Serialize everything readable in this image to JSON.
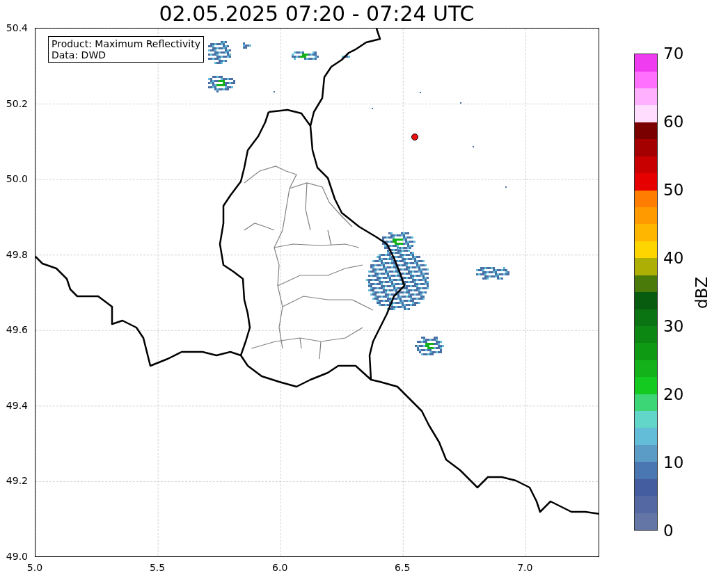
{
  "title": "02.05.2025 07:20 - 07:24 UTC",
  "legend": {
    "lines": [
      "Product: Maximum Reflectivity",
      "Data: DWD"
    ]
  },
  "axes": {
    "x_ticks": [
      "5.0",
      "5.5",
      "6.0",
      "6.5",
      "7.0"
    ],
    "y_ticks": [
      "50.4",
      "50.2",
      "50.0",
      "49.8",
      "49.6",
      "49.4",
      "49.2",
      "49.0"
    ]
  },
  "colorbar": {
    "label": "dBZ",
    "ticks": [
      "70",
      "60",
      "50",
      "40",
      "30",
      "20",
      "10",
      "0"
    ],
    "segments": [
      {
        "color": "#6376a6"
      },
      {
        "color": "#5468a3"
      },
      {
        "color": "#445da0"
      },
      {
        "color": "#4a77b2"
      },
      {
        "color": "#5b9cc6"
      },
      {
        "color": "#63bcd8"
      },
      {
        "color": "#62d6c8"
      },
      {
        "color": "#3dd676"
      },
      {
        "color": "#14c91f"
      },
      {
        "color": "#13b21a"
      },
      {
        "color": "#0f9a14"
      },
      {
        "color": "#0b8712"
      },
      {
        "color": "#0a7412"
      },
      {
        "color": "#085c0f"
      },
      {
        "color": "#4a7a09"
      },
      {
        "color": "#adaf05"
      },
      {
        "color": "#ffd500"
      },
      {
        "color": "#ffb600"
      },
      {
        "color": "#ff9a00"
      },
      {
        "color": "#ff7d00"
      },
      {
        "color": "#e60000"
      },
      {
        "color": "#c80000"
      },
      {
        "color": "#a50000"
      },
      {
        "color": "#7a0000"
      },
      {
        "color": "#ffddff"
      },
      {
        "color": "#ffb0ff"
      },
      {
        "color": "#ff70ff"
      },
      {
        "color": "#f03cf0"
      }
    ]
  }
}
